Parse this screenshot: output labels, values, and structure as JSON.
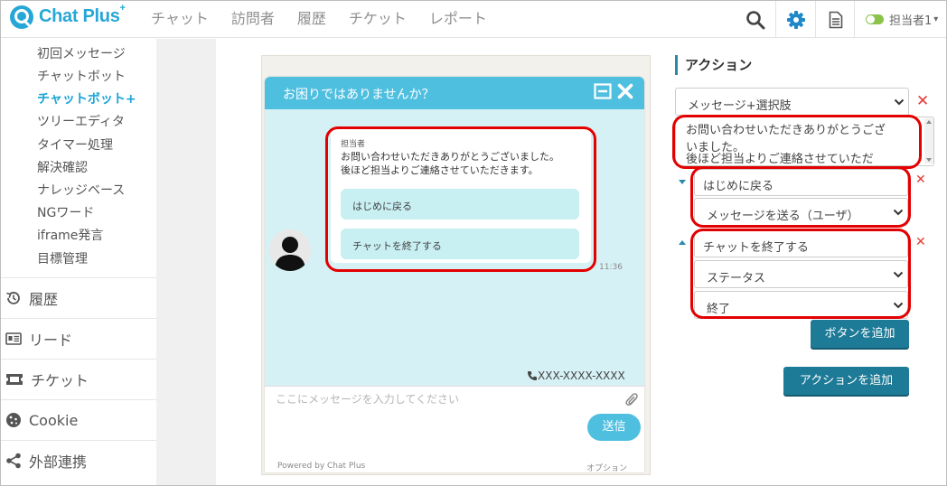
{
  "brand": {
    "name": "Chat Plus",
    "sup": "+"
  },
  "nav": [
    "チャット",
    "訪問者",
    "履歴",
    "チケット",
    "レポート"
  ],
  "header": {
    "agent_label": "担当者1",
    "agent_chevron": "▾"
  },
  "sidebar": {
    "sub_items": [
      "初回メッセージ",
      "チャットボット",
      "チャットボット+",
      "ツリーエディタ",
      "タイマー処理",
      "解決確認",
      "ナレッジベース",
      "NGワード",
      "iframe発言",
      "目標管理"
    ],
    "active_index": 2,
    "main_items": [
      "履歴",
      "リード",
      "チケット",
      "Cookie",
      "外部連携"
    ]
  },
  "chat": {
    "title": "お困りではありませんか？",
    "sender": "担当者",
    "message_line1": "お問い合わせいただきありがとうございました。",
    "message_line2": "後ほど担当よりご連絡させていただきます。",
    "option1": "はじめに戻る",
    "option2": "チャットを終了する",
    "time": "11:36",
    "phone": "XXX-XXXX-XXXX",
    "input_placeholder": "ここにメッセージを入力してください",
    "send": "送信",
    "powered": "Powered by Chat Plus",
    "option": "オプション"
  },
  "actions": {
    "title": "アクション",
    "type_select": "メッセージ+選択肢",
    "message_line1": "お問い合わせいただきありがとうござ",
    "message_line2": "いました。",
    "message_line3": "後ほど担当よりご連絡させていただ",
    "button1_label": "はじめに戻る",
    "button1_action": "メッセージを送る（ユーザ）",
    "button2_label": "チャットを終了する",
    "button2_action": "ステータス",
    "button2_value": "終了",
    "add_button": "ボタンを追加",
    "add_action": "アクションを追加",
    "delete": "✕"
  },
  "colors": {
    "accent": "#4fbfe0",
    "brand": "#27a7d6",
    "button": "#1e7b97",
    "highlight": "#e30000",
    "delete": "#e53935"
  }
}
